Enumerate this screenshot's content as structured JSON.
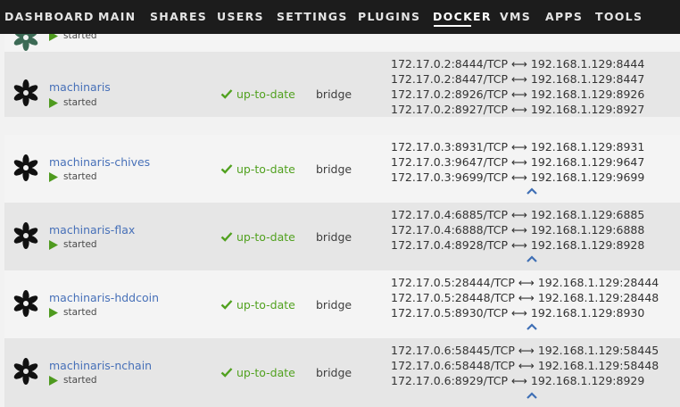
{
  "nav": {
    "items": [
      {
        "label": "DASHBOARD",
        "active": false
      },
      {
        "label": "MAIN",
        "active": false
      },
      {
        "label": "SHARES",
        "active": false
      },
      {
        "label": "USERS",
        "active": false
      },
      {
        "label": "SETTINGS",
        "active": false
      },
      {
        "label": "PLUGINS",
        "active": false
      },
      {
        "label": "DOCKER",
        "active": true
      },
      {
        "label": "VMS",
        "active": false
      },
      {
        "label": "APPS",
        "active": false
      },
      {
        "label": "TOOLS",
        "active": false
      }
    ]
  },
  "colors": {
    "nav_background": "#1c1c1c",
    "link": "#4770b8",
    "status_green": "#51a11f",
    "port_arrow_blue": "#3f6fb5"
  },
  "partial_row": {
    "state": "started"
  },
  "containers": [
    {
      "name": "machinaris",
      "state": "started",
      "version": "up-to-date",
      "network": "bridge",
      "icon": "machinaris-flower-icon",
      "ports": [
        "172.17.0.2:8444/TCP ⟷ 192.168.1.129:8444",
        "172.17.0.2:8447/TCP ⟷ 192.168.1.129:8447",
        "172.17.0.2:8926/TCP ⟷ 192.168.1.129:8926",
        "172.17.0.2:8927/TCP ⟷ 192.168.1.129:8927"
      ]
    },
    {
      "name": "machinaris-chives",
      "state": "started",
      "version": "up-to-date",
      "network": "bridge",
      "icon": "machinaris-flower-icon",
      "ports": [
        "172.17.0.3:8931/TCP ⟷ 192.168.1.129:8931",
        "172.17.0.3:9647/TCP ⟷ 192.168.1.129:9647",
        "172.17.0.3:9699/TCP ⟷ 192.168.1.129:9699"
      ]
    },
    {
      "name": "machinaris-flax",
      "state": "started",
      "version": "up-to-date",
      "network": "bridge",
      "icon": "machinaris-flower-icon",
      "ports": [
        "172.17.0.4:6885/TCP ⟷ 192.168.1.129:6885",
        "172.17.0.4:6888/TCP ⟷ 192.168.1.129:6888",
        "172.17.0.4:8928/TCP ⟷ 192.168.1.129:8928"
      ]
    },
    {
      "name": "machinaris-hddcoin",
      "state": "started",
      "version": "up-to-date",
      "network": "bridge",
      "icon": "machinaris-flower-icon",
      "ports": [
        "172.17.0.5:28444/TCP ⟷ 192.168.1.129:28444",
        "172.17.0.5:28448/TCP ⟷ 192.168.1.129:28448",
        "172.17.0.5:8930/TCP ⟷ 192.168.1.129:8930"
      ]
    },
    {
      "name": "machinaris-nchain",
      "state": "started",
      "version": "up-to-date",
      "network": "bridge",
      "icon": "machinaris-flower-icon",
      "ports": [
        "172.17.0.6:58445/TCP ⟷ 192.168.1.129:58445",
        "172.17.0.6:58448/TCP ⟷ 192.168.1.129:58448",
        "172.17.0.6:8929/TCP ⟷ 192.168.1.129:8929"
      ]
    }
  ]
}
